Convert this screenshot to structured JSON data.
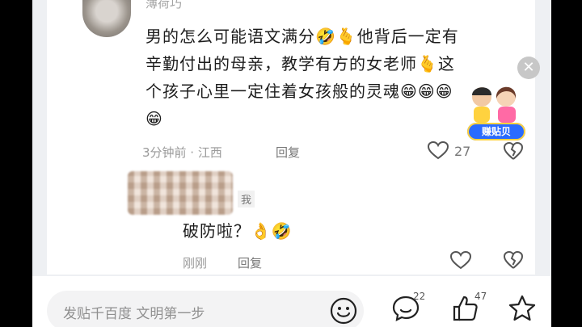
{
  "comment1": {
    "author": "薄荷巧",
    "text_lines": [
      "男的怎么可能语文满分🤣🫰他背后一定有",
      "辛勤付出的母亲，教学有方的女老师🫰这",
      "个孩子心里一定住着女孩般的灵魂😁😁😁",
      "😁"
    ],
    "meta": "3分钟前 · 江西",
    "reply_label": "回复",
    "like_count": "27"
  },
  "reply": {
    "author_tag": "我",
    "text": "破防啦？👌🤣",
    "time": "刚刚",
    "reply_label": "回复"
  },
  "promo": {
    "badge": "赚贴贝"
  },
  "bottom": {
    "placeholder": "发贴千百度 文明第一步",
    "comment_count": "22",
    "like_count": "47"
  },
  "colors": {
    "accent_blue": "#2a6bff",
    "text_primary": "#1d1d1d",
    "text_meta": "#9a9a9a"
  }
}
